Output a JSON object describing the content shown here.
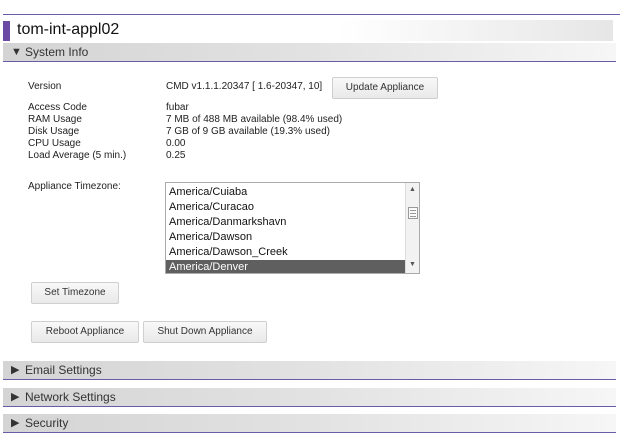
{
  "appliance_name": "tom-int-appl02",
  "system_info": {
    "section_label": "System Info",
    "version_label": "Version",
    "version_value": "CMD v1.1.1.20347 [ 1.6-20347, 10]",
    "update_button": "Update Appliance",
    "access_code_label": "Access Code",
    "access_code_value": "fubar",
    "ram_label": "RAM Usage",
    "ram_value": "7 MB of 488 MB available (98.4% used)",
    "disk_label": "Disk Usage",
    "disk_value": "7 GB of 9 GB available (19.3% used)",
    "cpu_label": "CPU Usage",
    "cpu_value": "0.00",
    "load_label": "Load Average (5 min.)",
    "load_value": "0.25",
    "timezone_label": "Appliance Timezone:",
    "timezone_options": [
      "America/Cuiaba",
      "America/Curacao",
      "America/Danmarkshavn",
      "America/Dawson",
      "America/Dawson_Creek",
      "America/Denver"
    ],
    "timezone_selected": "America/Denver",
    "set_timezone_button": "Set Timezone",
    "reboot_button": "Reboot Appliance",
    "shutdown_button": "Shut Down Appliance"
  },
  "sections": {
    "email": "Email Settings",
    "network": "Network Settings",
    "security": "Security"
  },
  "colors": {
    "accent": "#6b4aa3",
    "selected_option_bg": "#5f5f5f"
  }
}
